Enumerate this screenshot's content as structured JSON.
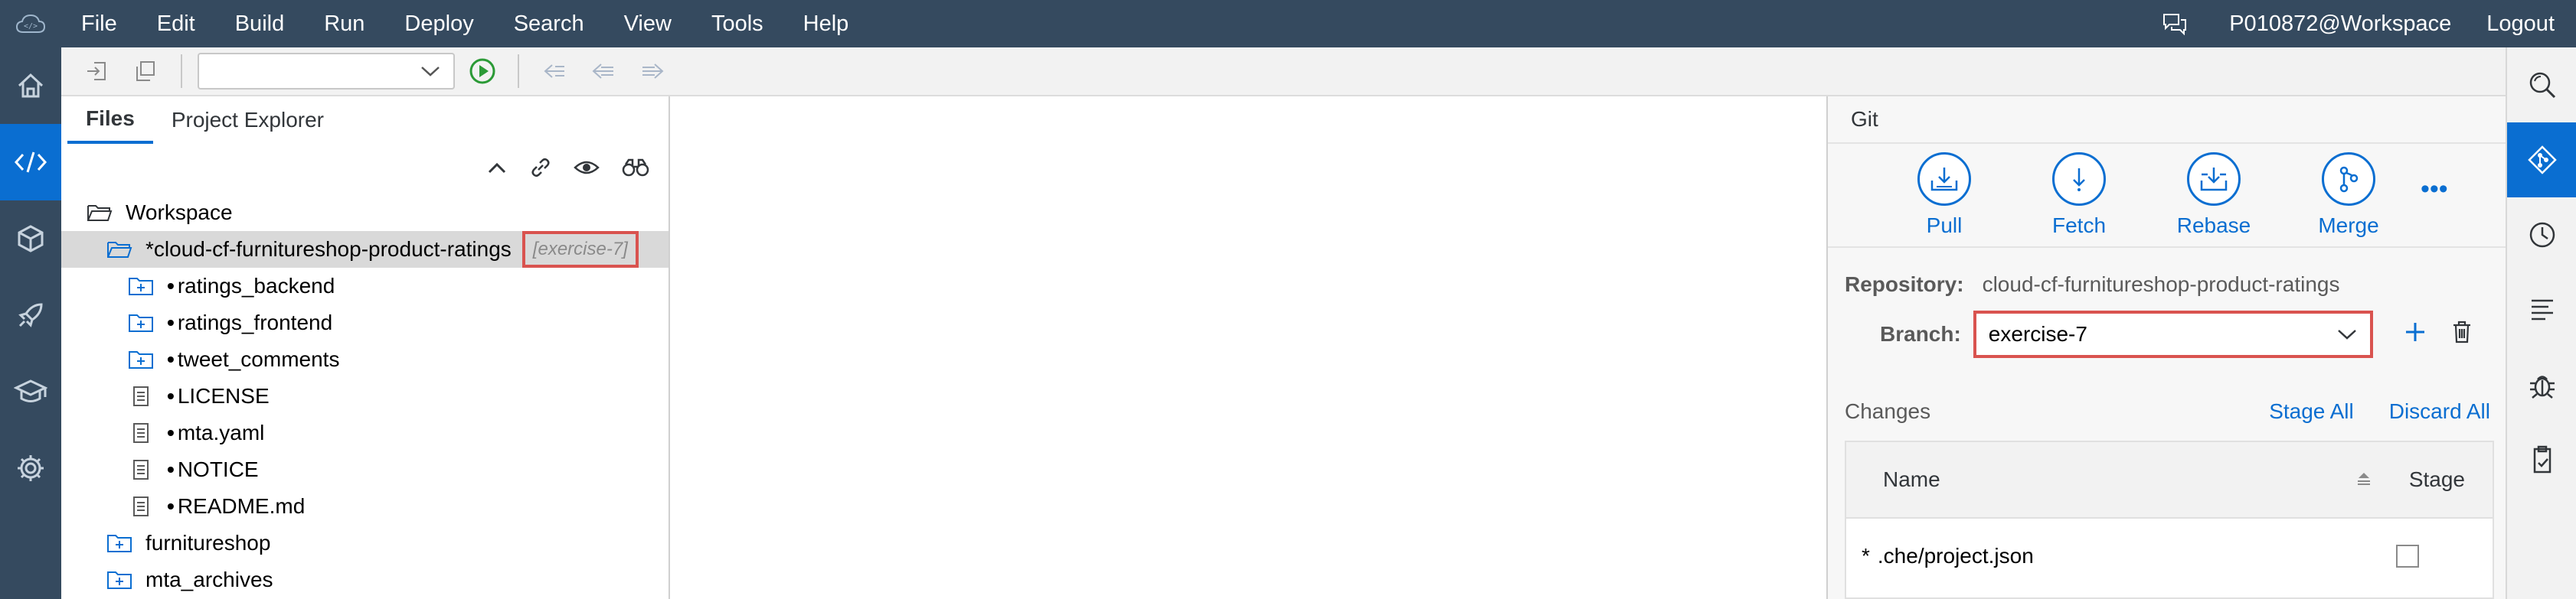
{
  "menubar": {
    "items": [
      "File",
      "Edit",
      "Build",
      "Run",
      "Deploy",
      "Search",
      "View",
      "Tools",
      "Help"
    ],
    "user": "P010872@Workspace",
    "logout": "Logout"
  },
  "left_sidebar": {
    "icons": [
      "home-icon",
      "code-icon",
      "cube-icon",
      "rocket-icon",
      "learn-icon",
      "settings-icon"
    ],
    "active": "code-icon"
  },
  "toolbar": {
    "run_config_value": ""
  },
  "files_panel": {
    "tabs": [
      "Files",
      "Project Explorer"
    ],
    "active_tab": "Files",
    "tree": [
      {
        "label": "Workspace",
        "type": "folder-open",
        "level": 0
      },
      {
        "label": "cloud-cf-furnitureshop-product-ratings",
        "prefix": "*",
        "branch": "[exercise-7]",
        "type": "folder-open",
        "level": 1,
        "selected": true
      },
      {
        "label": "ratings_backend",
        "prefix": "•",
        "type": "folder-plus",
        "level": 2
      },
      {
        "label": "ratings_frontend",
        "prefix": "•",
        "type": "folder-plus",
        "level": 2
      },
      {
        "label": "tweet_comments",
        "prefix": "•",
        "type": "folder-plus",
        "level": 2
      },
      {
        "label": "LICENSE",
        "prefix": "•",
        "type": "file",
        "level": 2
      },
      {
        "label": "mta.yaml",
        "prefix": "•",
        "type": "file",
        "level": 2
      },
      {
        "label": "NOTICE",
        "prefix": "•",
        "type": "file",
        "level": 2
      },
      {
        "label": "README.md",
        "prefix": "•",
        "type": "file",
        "level": 2
      },
      {
        "label": "furnitureshop",
        "type": "folder-plus",
        "level": 1
      },
      {
        "label": "mta_archives",
        "type": "folder-plus",
        "level": 1
      }
    ]
  },
  "git_panel": {
    "title": "Git",
    "actions": [
      "Pull",
      "Fetch",
      "Rebase",
      "Merge"
    ],
    "more": "•••",
    "repository_label": "Repository:",
    "repository_value": "cloud-cf-furnitureshop-product-ratings",
    "branch_label": "Branch:",
    "branch_value": "exercise-7",
    "changes_label": "Changes",
    "stage_all": "Stage All",
    "discard_all": "Discard All",
    "columns": [
      "Name",
      "Stage"
    ],
    "rows": [
      {
        "marker": "*",
        "name": ".che/project.json",
        "staged": false
      }
    ]
  },
  "right_sidebar": {
    "icons": [
      "search-icon",
      "git-icon",
      "history-icon",
      "outline-icon",
      "debug-icon",
      "clipboard-check-icon"
    ],
    "active": "git-icon"
  },
  "colors": {
    "menubar_bg": "#354a5f",
    "accent": "#0a6ed1",
    "highlight_border": "#d9534f"
  }
}
